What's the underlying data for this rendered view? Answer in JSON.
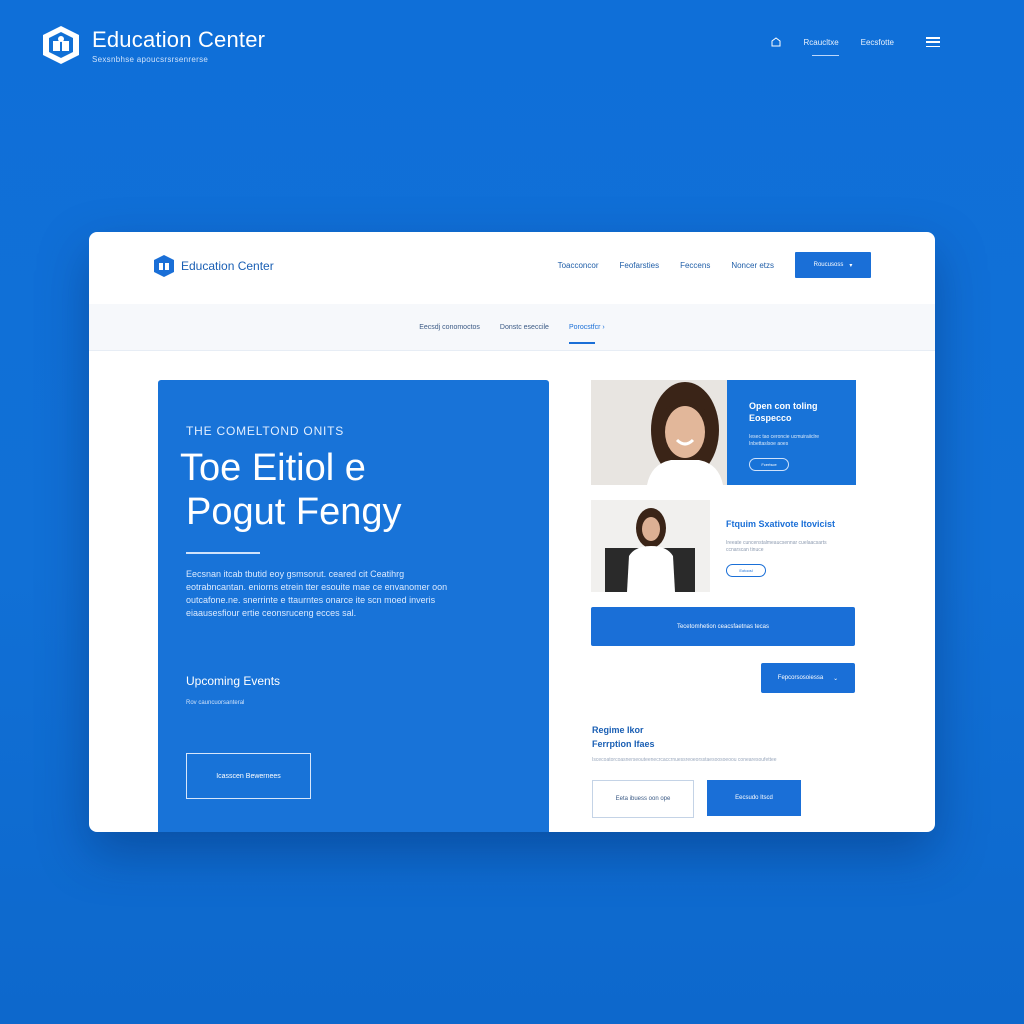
{
  "brand": {
    "title": "Education Center",
    "subtitle": "Sexsnbhse apoucsrsrsenrerse"
  },
  "topnav": {
    "items": [
      "Rcaucltxe",
      "Eecsfotte"
    ],
    "icons": [
      "home-icon",
      "menu-icon"
    ]
  },
  "card": {
    "brand_title": "Education Center",
    "nav": [
      "Toacconcor",
      "Feofarsties",
      "Feccens",
      "Noncer etzs"
    ],
    "cta_label": "Roucusoss",
    "subnav": [
      "Eecsdj conomoctos",
      "Donstc eseccile",
      "Porocstfcr"
    ],
    "hero": {
      "kicker": "THE COMELTOND ONITS",
      "title_line1": "Toe Eitiol e",
      "title_line2": "Pogut Fengy",
      "body": "Eecsnan itcab   tbutid    eoy gsmsorut.   ceared   cit    Ceatihrg eotrabncantan. eniorns etrein tter esouite mae ce envanomer oon outcafone.ne. snerrinte e ttaurntes onarce  ite scn moed inveris eiaausesfiour ertie ceonsruceng ecces sal.",
      "events_title": "Upcoming Events",
      "events_sub": "Rov cauncuorsanteral",
      "button": "Icasscen Bewernees"
    },
    "features": [
      {
        "title": "Open con toling Eospecco",
        "sub": "Iesec tao ceroncie ucmuiraiiclre Inbettaslsoe aoes",
        "pill": "Fcertsce"
      },
      {
        "title": "Ftquim Sxativote Itovicist",
        "sub": "Ireeate cuncenstalmeaucsennar cuelaacsarts ccnarscan tinuce",
        "pill": "Eotoosl"
      }
    ],
    "wide_button": "Tecetomhetion ceacsfaetnas tecas",
    "dropdown_button": "Fepcorsosoiessa",
    "register": {
      "title_line1": "Regime Ikor",
      "title_line2": "Ferrption Ifaes",
      "sub": "Iscecoatorcoasnerseouteenecrcaccrnuessreoeorsstaesoosoeoou conearesoufettee",
      "btn_outline": "Eeta ibuess oon ope",
      "btn_filled": "Eecsudo    Itscd"
    }
  },
  "colors": {
    "background": "#1170d6",
    "accent": "#1a6fd7",
    "card": "#ffffff"
  }
}
